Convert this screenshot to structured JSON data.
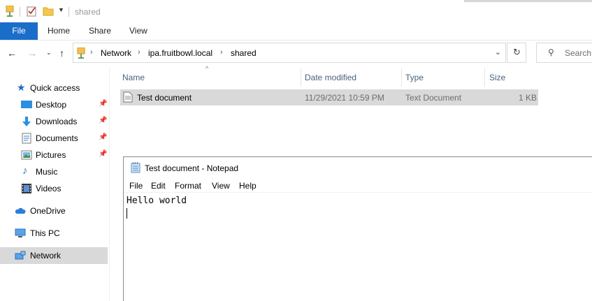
{
  "window": {
    "title": "shared"
  },
  "ribbon": {
    "tabs": [
      {
        "label": "File"
      },
      {
        "label": "Home"
      },
      {
        "label": "Share"
      },
      {
        "label": "View"
      }
    ]
  },
  "address": {
    "path": [
      "Network",
      "ipa.fruitbowl.local",
      "shared"
    ]
  },
  "search": {
    "placeholder": "Search sh"
  },
  "nav": {
    "items": [
      {
        "label": "Quick access",
        "icon": "star-icon"
      },
      {
        "label": "Desktop",
        "icon": "desktop-icon",
        "pinned": true
      },
      {
        "label": "Downloads",
        "icon": "downloads-icon",
        "pinned": true
      },
      {
        "label": "Documents",
        "icon": "documents-icon",
        "pinned": true
      },
      {
        "label": "Pictures",
        "icon": "pictures-icon",
        "pinned": true
      },
      {
        "label": "Music",
        "icon": "music-icon"
      },
      {
        "label": "Videos",
        "icon": "videos-icon"
      },
      {
        "label": "OneDrive",
        "icon": "cloud-icon"
      },
      {
        "label": "This PC",
        "icon": "computer-icon"
      },
      {
        "label": "Network",
        "icon": "network-icon",
        "selected": true
      }
    ]
  },
  "filelist": {
    "columns": [
      "Name",
      "Date modified",
      "Type",
      "Size"
    ],
    "rows": [
      {
        "name": "Test document",
        "date": "11/29/2021 10:59 PM",
        "type": "Text Document",
        "size": "1 KB"
      }
    ]
  },
  "notepad": {
    "title": "Test document - Notepad",
    "menu": [
      "File",
      "Edit",
      "Format",
      "View",
      "Help"
    ],
    "content": "Hello world"
  },
  "colors": {
    "accent": "#1a6dc9",
    "selection": "#d9d9d9",
    "header_text": "#4c607a"
  }
}
